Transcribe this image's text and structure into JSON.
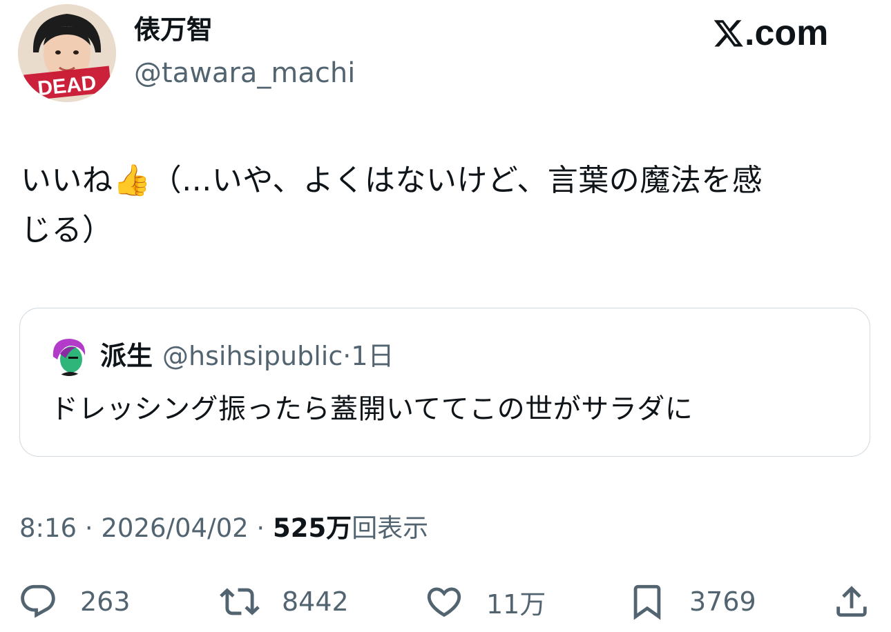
{
  "author": {
    "name": "俵万智",
    "handle": "@tawara_machi",
    "avatar_badge": "DEAD"
  },
  "brand": {
    "label": ".com",
    "icon": "x-logo-icon"
  },
  "tweet": {
    "text_line1": "いいね👍（...いや、よくはないけど、言葉の魔法を感",
    "text_line2": "じる）"
  },
  "quote": {
    "name": "派生",
    "handle": "@hsihsipublic",
    "separator": "·",
    "time": "1日",
    "text": "ドレッシング振ったら蓋開いててこの世がサラダに"
  },
  "meta": {
    "time": "8:16",
    "sep1": " · ",
    "date": "2026/04/02",
    "sep2": " · ",
    "views_count": "525万",
    "views_label": "回表示"
  },
  "actions": {
    "replies": "263",
    "reposts": "8442",
    "likes": "11万",
    "bookmarks": "3769"
  },
  "colors": {
    "text": "#0f1419",
    "secondary": "#536471",
    "border": "#cfd9de",
    "badge_red": "#c8102e"
  }
}
